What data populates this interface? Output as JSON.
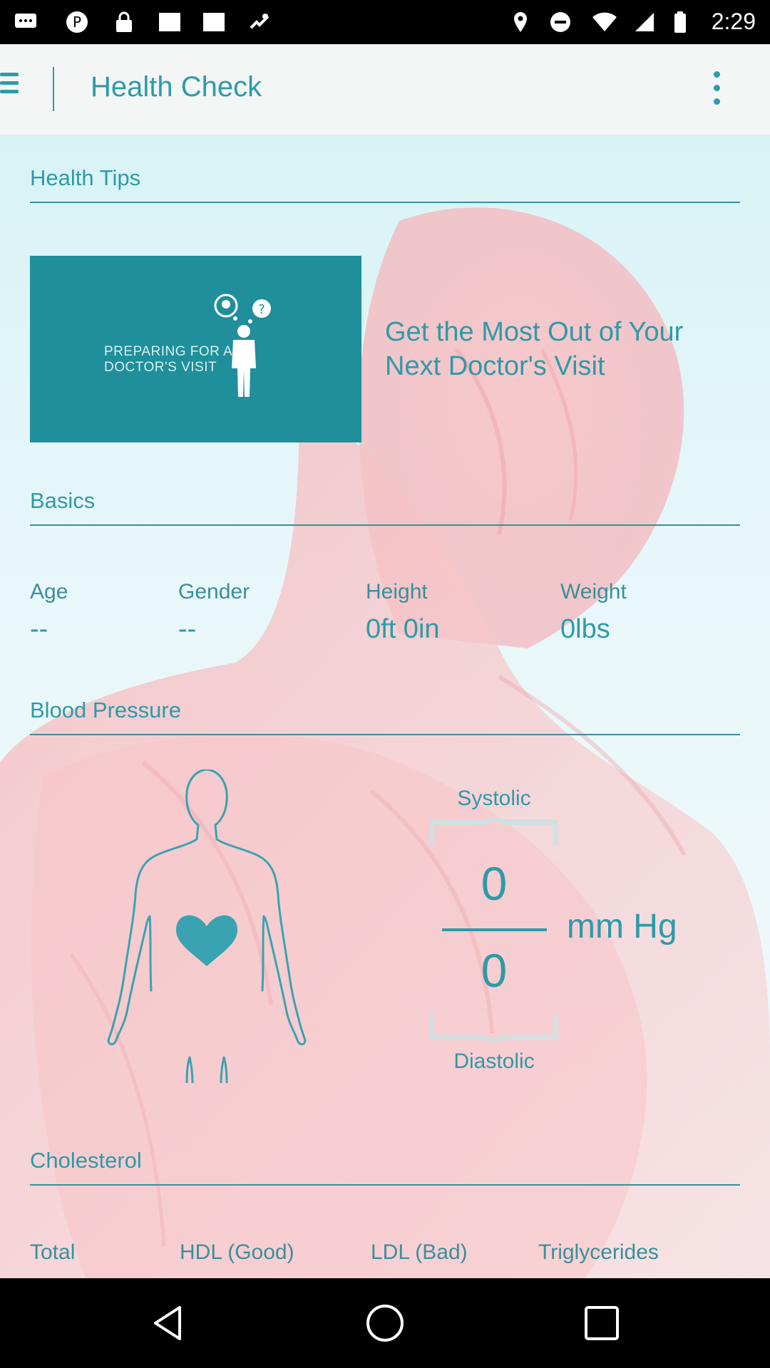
{
  "status_bar": {
    "time": "2:29",
    "icons": [
      "messages-icon",
      "pinterest-icon",
      "lock-icon",
      "image-icon",
      "image-icon",
      "fake-gps-icon",
      "location-icon",
      "do-not-disturb-icon",
      "wifi-icon",
      "signal-icon",
      "battery-icon"
    ]
  },
  "app_bar": {
    "title": "Health Check"
  },
  "health_tips": {
    "heading": "Health Tips",
    "card_text_line1": "PREPARING FOR A",
    "card_text_line2": "DOCTOR'S VISIT",
    "tip_title": "Get the Most Out of Your Next Doctor's Visit"
  },
  "basics": {
    "heading": "Basics",
    "age_label": "Age",
    "age_value": "--",
    "gender_label": "Gender",
    "gender_value": "--",
    "height_label": "Height",
    "height_value": "0ft 0in",
    "weight_label": "Weight",
    "weight_value": "0lbs"
  },
  "blood_pressure": {
    "heading": "Blood Pressure",
    "systolic_label": "Systolic",
    "systolic_value": "0",
    "diastolic_label": "Diastolic",
    "diastolic_value": "0",
    "unit": "mm Hg"
  },
  "cholesterol": {
    "heading": "Cholesterol",
    "total_label": "Total",
    "hdl_label": "HDL (Good)",
    "ldl_label": "LDL (Bad)",
    "triglycerides_label": "Triglycerides"
  },
  "colors": {
    "accent": "#2e9aa8",
    "card": "#1f8f9b",
    "background_tint": "#d8f3f6",
    "anatomy_pink": "#f4b8bd"
  }
}
